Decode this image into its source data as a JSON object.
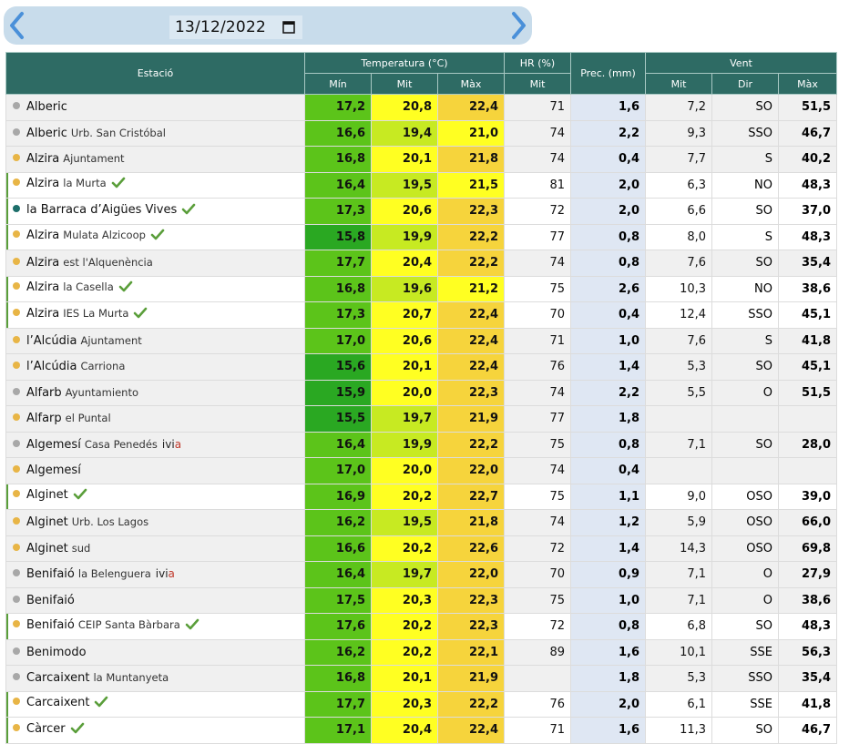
{
  "date": "13/12/2022",
  "colors": {
    "header": "#2e6b64",
    "grey_dot": "#a8a8a8",
    "orange_dot": "#e8b546",
    "teal_dot": "#1d6e6a",
    "check": "#5a9e3a"
  },
  "icons": {
    "prev": "chevron-left-icon",
    "next": "chevron-right-icon",
    "calendar": "calendar-icon",
    "check": "checkmark-icon"
  },
  "headers": {
    "station": "Estació",
    "temperature": "Temperatura (°C)",
    "hr": "HR (%)",
    "prec": "Prec. (mm)",
    "wind": "Vent",
    "tmin": "Mín",
    "tmid": "Mit",
    "tmax": "Màx",
    "hr_mid": "Mit",
    "w_mid": "Mit",
    "w_dir": "Dir",
    "w_max": "Màx"
  },
  "rows": [
    {
      "dot": "grey",
      "name": "Alberic",
      "sub": "",
      "check": false,
      "ivia": false,
      "hl": false,
      "tmin": "17,2",
      "tmid": "20,8",
      "tmax": "22,4",
      "hr": "71",
      "prec": "1,6",
      "wmid": "7,2",
      "wdir": "SO",
      "wmax": "51,5",
      "cmin": "#5cc41a",
      "cmid": "#ffff22",
      "cmax": "#f6d43c"
    },
    {
      "dot": "grey",
      "name": "Alberic",
      "sub": "Urb. San Cristóbal",
      "check": false,
      "ivia": false,
      "hl": false,
      "tmin": "16,6",
      "tmid": "19,4",
      "tmax": "21,0",
      "hr": "74",
      "prec": "2,2",
      "wmid": "9,3",
      "wdir": "SSO",
      "wmax": "46,7",
      "cmin": "#5cc41a",
      "cmid": "#c7ea22",
      "cmax": "#ffff22"
    },
    {
      "dot": "orange",
      "name": "Alzira",
      "sub": "Ajuntament",
      "check": false,
      "ivia": false,
      "hl": false,
      "tmin": "16,8",
      "tmid": "20,1",
      "tmax": "21,8",
      "hr": "74",
      "prec": "0,4",
      "wmid": "7,7",
      "wdir": "S",
      "wmax": "40,2",
      "cmin": "#5cc41a",
      "cmid": "#ffff22",
      "cmax": "#f6d43c"
    },
    {
      "dot": "orange",
      "name": "Alzira",
      "sub": "la Murta",
      "check": true,
      "ivia": false,
      "hl": true,
      "tmin": "16,4",
      "tmid": "19,5",
      "tmax": "21,5",
      "hr": "81",
      "prec": "2,0",
      "wmid": "6,3",
      "wdir": "NO",
      "wmax": "48,3",
      "cmin": "#5cc41a",
      "cmid": "#c7ea22",
      "cmax": "#ffff22"
    },
    {
      "dot": "teal",
      "name": "la Barraca d’Aigües Vives",
      "sub": "",
      "check": true,
      "ivia": false,
      "hl": true,
      "tmin": "17,3",
      "tmid": "20,6",
      "tmax": "22,3",
      "hr": "72",
      "prec": "2,0",
      "wmid": "6,6",
      "wdir": "SO",
      "wmax": "37,0",
      "cmin": "#5cc41a",
      "cmid": "#ffff22",
      "cmax": "#f6d43c"
    },
    {
      "dot": "orange",
      "name": "Alzira",
      "sub": "Mulata Alzicoop",
      "check": true,
      "ivia": false,
      "hl": true,
      "tmin": "15,8",
      "tmid": "19,9",
      "tmax": "22,2",
      "hr": "77",
      "prec": "0,8",
      "wmid": "8,0",
      "wdir": "S",
      "wmax": "48,3",
      "cmin": "#2aa822",
      "cmid": "#c7ea22",
      "cmax": "#f6d43c"
    },
    {
      "dot": "orange",
      "name": "Alzira",
      "sub": "est l'Alquenència",
      "check": false,
      "ivia": false,
      "hl": false,
      "tmin": "17,7",
      "tmid": "20,4",
      "tmax": "22,2",
      "hr": "74",
      "prec": "0,8",
      "wmid": "7,6",
      "wdir": "SO",
      "wmax": "35,4",
      "cmin": "#5cc41a",
      "cmid": "#ffff22",
      "cmax": "#f6d43c"
    },
    {
      "dot": "orange",
      "name": "Alzira",
      "sub": "la Casella",
      "check": true,
      "ivia": false,
      "hl": true,
      "tmin": "16,8",
      "tmid": "19,6",
      "tmax": "21,2",
      "hr": "75",
      "prec": "2,6",
      "wmid": "10,3",
      "wdir": "NO",
      "wmax": "38,6",
      "cmin": "#5cc41a",
      "cmid": "#c7ea22",
      "cmax": "#ffff22"
    },
    {
      "dot": "orange",
      "name": "Alzira",
      "sub": "IES La Murta",
      "check": true,
      "ivia": false,
      "hl": true,
      "tmin": "17,3",
      "tmid": "20,7",
      "tmax": "22,4",
      "hr": "70",
      "prec": "0,4",
      "wmid": "12,4",
      "wdir": "SSO",
      "wmax": "45,1",
      "cmin": "#5cc41a",
      "cmid": "#ffff22",
      "cmax": "#f6d43c"
    },
    {
      "dot": "orange",
      "name": "l’Alcúdia",
      "sub": "Ajuntament",
      "check": false,
      "ivia": false,
      "hl": false,
      "tmin": "17,0",
      "tmid": "20,6",
      "tmax": "22,4",
      "hr": "71",
      "prec": "1,0",
      "wmid": "7,6",
      "wdir": "S",
      "wmax": "41,8",
      "cmin": "#5cc41a",
      "cmid": "#ffff22",
      "cmax": "#f6d43c"
    },
    {
      "dot": "orange",
      "name": "l’Alcúdia",
      "sub": "Carriona",
      "check": false,
      "ivia": false,
      "hl": false,
      "tmin": "15,6",
      "tmid": "20,1",
      "tmax": "22,4",
      "hr": "76",
      "prec": "1,4",
      "wmid": "5,3",
      "wdir": "SO",
      "wmax": "45,1",
      "cmin": "#2aa822",
      "cmid": "#ffff22",
      "cmax": "#f6d43c"
    },
    {
      "dot": "grey",
      "name": "Alfarb",
      "sub": "Ayuntamiento",
      "check": false,
      "ivia": false,
      "hl": false,
      "tmin": "15,9",
      "tmid": "20,0",
      "tmax": "22,3",
      "hr": "74",
      "prec": "2,2",
      "wmid": "5,5",
      "wdir": "O",
      "wmax": "51,5",
      "cmin": "#2aa822",
      "cmid": "#ffff22",
      "cmax": "#f6d43c"
    },
    {
      "dot": "orange",
      "name": "Alfarp",
      "sub": "el Puntal",
      "check": false,
      "ivia": false,
      "hl": false,
      "tmin": "15,5",
      "tmid": "19,7",
      "tmax": "21,9",
      "hr": "77",
      "prec": "1,8",
      "wmid": "",
      "wdir": "",
      "wmax": "",
      "cmin": "#2aa822",
      "cmid": "#c7ea22",
      "cmax": "#f6d43c"
    },
    {
      "dot": "grey",
      "name": "Algemesí",
      "sub": "Casa Penedés",
      "check": false,
      "ivia": true,
      "hl": false,
      "tmin": "16,4",
      "tmid": "19,9",
      "tmax": "22,2",
      "hr": "75",
      "prec": "0,8",
      "wmid": "7,1",
      "wdir": "SO",
      "wmax": "28,0",
      "cmin": "#5cc41a",
      "cmid": "#c7ea22",
      "cmax": "#f6d43c"
    },
    {
      "dot": "orange",
      "name": "Algemesí",
      "sub": "",
      "check": false,
      "ivia": false,
      "hl": false,
      "tmin": "17,0",
      "tmid": "20,0",
      "tmax": "22,0",
      "hr": "74",
      "prec": "0,4",
      "wmid": "",
      "wdir": "",
      "wmax": "",
      "cmin": "#5cc41a",
      "cmid": "#ffff22",
      "cmax": "#f6d43c"
    },
    {
      "dot": "orange",
      "name": "Alginet",
      "sub": "",
      "check": true,
      "ivia": false,
      "hl": true,
      "tmin": "16,9",
      "tmid": "20,2",
      "tmax": "22,7",
      "hr": "75",
      "prec": "1,1",
      "wmid": "9,0",
      "wdir": "OSO",
      "wmax": "39,0",
      "cmin": "#5cc41a",
      "cmid": "#ffff22",
      "cmax": "#f6d43c"
    },
    {
      "dot": "orange",
      "name": "Alginet",
      "sub": "Urb. Los Lagos",
      "check": false,
      "ivia": false,
      "hl": false,
      "tmin": "16,2",
      "tmid": "19,5",
      "tmax": "21,8",
      "hr": "74",
      "prec": "1,2",
      "wmid": "5,9",
      "wdir": "OSO",
      "wmax": "66,0",
      "cmin": "#5cc41a",
      "cmid": "#c7ea22",
      "cmax": "#f6d43c"
    },
    {
      "dot": "orange",
      "name": "Alginet",
      "sub": "sud",
      "check": false,
      "ivia": false,
      "hl": false,
      "tmin": "16,6",
      "tmid": "20,2",
      "tmax": "22,6",
      "hr": "72",
      "prec": "1,4",
      "wmid": "14,3",
      "wdir": "OSO",
      "wmax": "69,8",
      "cmin": "#5cc41a",
      "cmid": "#ffff22",
      "cmax": "#f6d43c"
    },
    {
      "dot": "grey",
      "name": "Benifaió",
      "sub": "la Belenguera",
      "check": false,
      "ivia": true,
      "hl": false,
      "tmin": "16,4",
      "tmid": "19,7",
      "tmax": "22,0",
      "hr": "70",
      "prec": "0,9",
      "wmid": "7,1",
      "wdir": "O",
      "wmax": "27,9",
      "cmin": "#5cc41a",
      "cmid": "#c7ea22",
      "cmax": "#f6d43c"
    },
    {
      "dot": "grey",
      "name": "Benifaió",
      "sub": "",
      "check": false,
      "ivia": false,
      "hl": false,
      "tmin": "17,5",
      "tmid": "20,3",
      "tmax": "22,3",
      "hr": "75",
      "prec": "1,0",
      "wmid": "7,1",
      "wdir": "O",
      "wmax": "38,6",
      "cmin": "#5cc41a",
      "cmid": "#ffff22",
      "cmax": "#f6d43c"
    },
    {
      "dot": "orange",
      "name": "Benifaió",
      "sub": "CEIP Santa Bàrbara",
      "check": true,
      "ivia": false,
      "hl": true,
      "tmin": "17,6",
      "tmid": "20,2",
      "tmax": "22,3",
      "hr": "72",
      "prec": "0,8",
      "wmid": "6,8",
      "wdir": "SO",
      "wmax": "48,3",
      "cmin": "#5cc41a",
      "cmid": "#ffff22",
      "cmax": "#f6d43c"
    },
    {
      "dot": "grey",
      "name": "Benimodo",
      "sub": "",
      "check": false,
      "ivia": false,
      "hl": false,
      "tmin": "16,2",
      "tmid": "20,2",
      "tmax": "22,1",
      "hr": "89",
      "prec": "1,6",
      "wmid": "10,1",
      "wdir": "SSE",
      "wmax": "56,3",
      "cmin": "#5cc41a",
      "cmid": "#ffff22",
      "cmax": "#f6d43c"
    },
    {
      "dot": "grey",
      "name": "Carcaixent",
      "sub": "la Muntanyeta",
      "check": false,
      "ivia": false,
      "hl": false,
      "tmin": "16,8",
      "tmid": "20,1",
      "tmax": "21,9",
      "hr": "",
      "prec": "1,8",
      "wmid": "5,3",
      "wdir": "SSO",
      "wmax": "35,4",
      "cmin": "#5cc41a",
      "cmid": "#ffff22",
      "cmax": "#f6d43c"
    },
    {
      "dot": "orange",
      "name": "Carcaixent",
      "sub": "",
      "check": true,
      "ivia": false,
      "hl": true,
      "tmin": "17,7",
      "tmid": "20,3",
      "tmax": "22,2",
      "hr": "76",
      "prec": "2,0",
      "wmid": "6,1",
      "wdir": "SSE",
      "wmax": "41,8",
      "cmin": "#5cc41a",
      "cmid": "#ffff22",
      "cmax": "#f6d43c"
    },
    {
      "dot": "orange",
      "name": "Càrcer",
      "sub": "",
      "check": true,
      "ivia": false,
      "hl": true,
      "tmin": "17,1",
      "tmid": "20,4",
      "tmax": "22,4",
      "hr": "71",
      "prec": "1,6",
      "wmid": "11,3",
      "wdir": "SO",
      "wmax": "46,7",
      "cmin": "#5cc41a",
      "cmid": "#ffff22",
      "cmax": "#f6d43c"
    }
  ]
}
